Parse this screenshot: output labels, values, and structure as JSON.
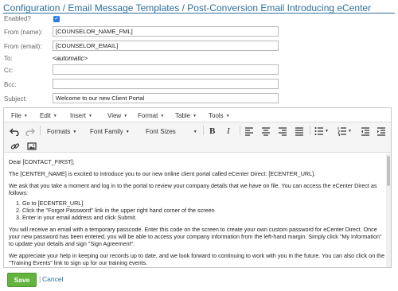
{
  "breadcrumb": {
    "items": [
      "Configuration",
      "Email Message Templates",
      "Post-Conversion Email Introducing eCenter"
    ],
    "separator": "/"
  },
  "form": {
    "enabled_label": "Enabled?",
    "enabled_checked": true,
    "from_name_label": "From (name):",
    "from_name_value": "[COUNSELOR_NAME_FML]",
    "from_email_label": "From (email):",
    "from_email_value": "[COUNSELOR_EMAIL]",
    "to_label": "To:",
    "to_value": "<automatic>",
    "cc_label": "Cc:",
    "cc_value": "",
    "bcc_label": "Bcc:",
    "bcc_value": "",
    "subject_label": "Subject:",
    "subject_value": "Welcome to our new Client Portal"
  },
  "editor": {
    "menus": [
      "File",
      "Edit",
      "Insert",
      "View",
      "Format",
      "Table",
      "Tools"
    ],
    "toolbar": {
      "formats": "Formats",
      "font_family": "Font Family",
      "font_sizes": "Font Sizes"
    },
    "icons": [
      "undo-icon",
      "redo-icon",
      "bold-icon",
      "italic-icon",
      "align-left-icon",
      "align-center-icon",
      "align-right-icon",
      "align-justify-icon",
      "bullet-list-icon",
      "numbered-list-icon",
      "outdent-icon",
      "indent-icon",
      "link-icon",
      "image-icon"
    ],
    "body": {
      "greeting": "Dear [CONTACT_FIRST];",
      "p1": "The [CENTER_NAME] is excited to introduce you to our new online client portal called eCenter Direct: [ECENTER_URL].",
      "p2": "We ask that you take a moment and log in to the portal to review your company details that we have on file.  You can access the eCenter Direct as follows:",
      "steps": [
        "Go to [ECENTER_URL]",
        "Click the \"Forgot Password\" link in the upper right hand corner of the screen",
        "Enter in your email address and click Submit."
      ],
      "p3": "You will receive an email with a temporary passcode. Enter this code on the screen to create your own custom password for eCenter Direct. Once your new password has been entered, you will be able to access your company information from the left-hand margin.  Simply click \"My Information\" to update your details and sign \"Sign Agreement\".",
      "p4": "We appreciate your help in keeping our records up to date, and we look forward to continuing to work with you in the future.  You can also click on the \"Training Events\" link to sign up for our training events."
    }
  },
  "actions": {
    "save": "Save",
    "divider": "|",
    "cancel": "Cancel"
  },
  "colors": {
    "link": "#2f6f9a",
    "save_button": "#63b33e",
    "checkbox": "#2d7ee8"
  }
}
